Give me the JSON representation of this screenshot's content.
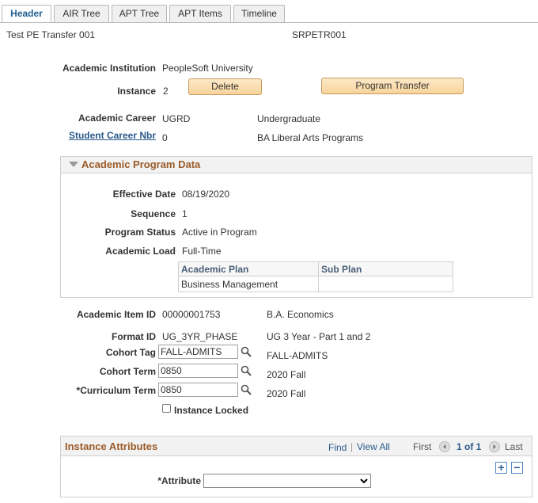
{
  "tabs": [
    "Header",
    "AIR Tree",
    "APT Tree",
    "APT Items",
    "Timeline"
  ],
  "header": {
    "name": "Test PE Transfer 001",
    "id": "SRPETR001"
  },
  "institution": {
    "label": "Academic Institution",
    "value": "PeopleSoft University"
  },
  "instance": {
    "label": "Instance",
    "value": "2",
    "delete_btn": "Delete",
    "transfer_btn": "Program Transfer"
  },
  "career": {
    "label": "Academic Career",
    "code": "UGRD",
    "desc": "Undergraduate"
  },
  "career_nbr": {
    "label": "Student Career Nbr",
    "value": "0",
    "desc": "BA Liberal Arts Programs"
  },
  "program": {
    "title": "Academic Program Data",
    "effdt_label": "Effective Date",
    "effdt": "08/19/2020",
    "seq_label": "Sequence",
    "seq": "1",
    "status_label": "Program Status",
    "status": "Active in Program",
    "load_label": "Academic Load",
    "load": "Full-Time",
    "plan_header": "Academic Plan",
    "subplan_header": "Sub Plan",
    "plan": "Business Management",
    "subplan": ""
  },
  "item": {
    "label": "Academic Item ID",
    "value": "00000001753",
    "desc": "B.A. Economics"
  },
  "format": {
    "label": "Format ID",
    "value": "UG_3YR_PHASE",
    "desc": "UG 3 Year - Part 1 and 2"
  },
  "cohort_tag": {
    "label": "Cohort Tag",
    "value": "FALL-ADMITS",
    "desc": "FALL-ADMITS"
  },
  "cohort_term": {
    "label": "Cohort Term",
    "value": "0850",
    "desc": "2020 Fall"
  },
  "curr_term": {
    "label": "*Curriculum Term",
    "value": "0850",
    "desc": "2020 Fall"
  },
  "locked": {
    "label": "Instance Locked"
  },
  "attributes": {
    "title": "Instance Attributes",
    "find": "Find",
    "sep": "|",
    "view_all": "View All",
    "first": "First",
    "pager": "1 of 1",
    "last": "Last",
    "attr_label": "*Attribute",
    "attr_value": ""
  },
  "colors": {
    "accent": "#9b5b28",
    "link": "#2a5a8c",
    "button": "#f7d49b"
  }
}
